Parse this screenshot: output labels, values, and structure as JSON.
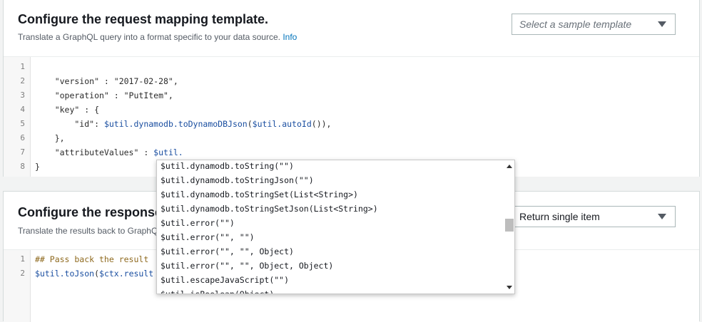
{
  "request": {
    "title": "Configure the request mapping template.",
    "subtitle": "Translate a GraphQL query into a format specific to your data source.",
    "info_link": "Info",
    "sample_select": "Select a sample template",
    "lines": [
      {
        "n": "1",
        "text": ""
      },
      {
        "n": "2",
        "text": "    \"version\" : \"2017-02-28\","
      },
      {
        "n": "3",
        "text": "    \"operation\" : \"PutItem\","
      },
      {
        "n": "4",
        "text": "    \"key\" : {"
      },
      {
        "n": "5",
        "text": "        \"id\": $util.dynamodb.toDynamoDBJson($util.autoId()),"
      },
      {
        "n": "6",
        "text": "    },"
      },
      {
        "n": "7",
        "text": "    \"attributeValues\" : $util."
      },
      {
        "n": "8",
        "text": "}"
      }
    ]
  },
  "response": {
    "title": "Configure the response",
    "subtitle": "Translate the results back to GraphQ",
    "return_select": "Return single item",
    "lines": [
      {
        "n": "1",
        "text": "## Pass back the result"
      },
      {
        "n": "2",
        "text": "$util.toJson($ctx.result"
      }
    ]
  },
  "autocomplete": {
    "items": [
      "$util.dynamodb.toString(\"\")",
      "$util.dynamodb.toStringJson(\"\")",
      "$util.dynamodb.toStringSet(List<String>)",
      "$util.dynamodb.toStringSetJson(List<String>)",
      "$util.error(\"\")",
      "$util.error(\"\", \"\")",
      "$util.error(\"\", \"\", Object)",
      "$util.error(\"\", \"\", Object, Object)",
      "$util.escapeJavaScript(\"\")",
      "$util.isBoolean(Object)"
    ]
  },
  "colors": {
    "link": "#0073bb",
    "comment": "#8f6a1f",
    "title": "#16191f"
  }
}
